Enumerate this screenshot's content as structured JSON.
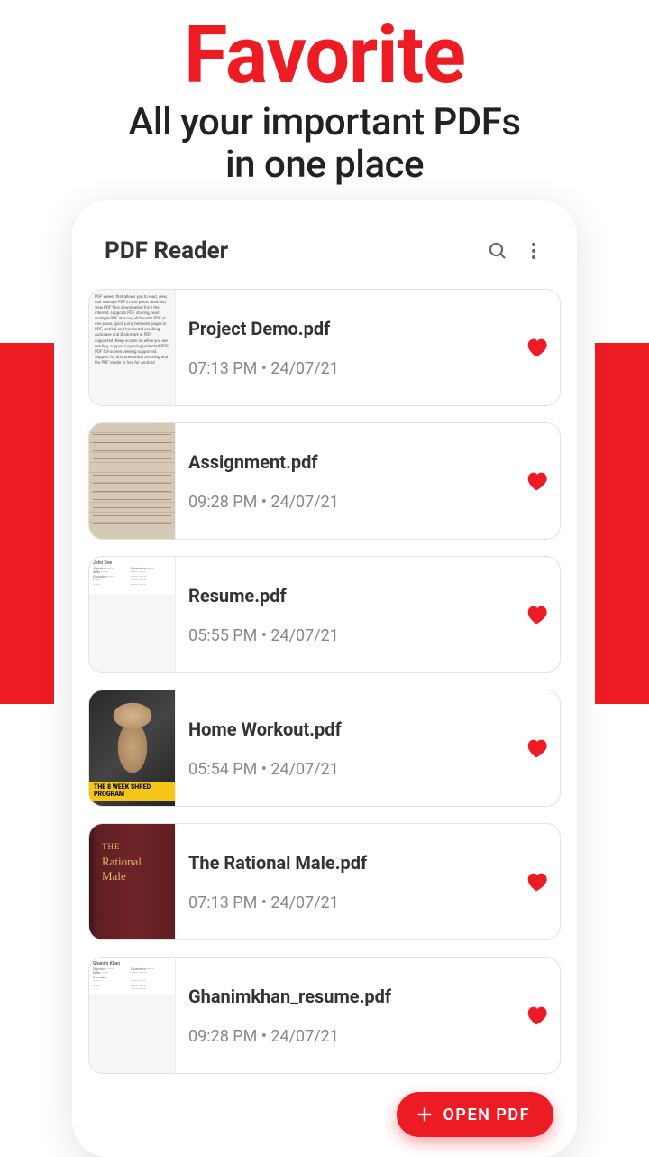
{
  "hero": {
    "title": "Favorite",
    "subtitle_line1": "All your important PDFs",
    "subtitle_line2": "in one place"
  },
  "app": {
    "title": "PDF Reader",
    "fab_label": "OPEN PDF"
  },
  "files": [
    {
      "name": "Project Demo.pdf",
      "meta": "07:13 PM • 24/07/21"
    },
    {
      "name": "Assignment.pdf",
      "meta": "09:28 PM • 24/07/21"
    },
    {
      "name": "Resume.pdf",
      "meta": "05:55 PM • 24/07/21"
    },
    {
      "name": "Home Workout.pdf",
      "meta": "05:54 PM • 24/07/21"
    },
    {
      "name": "The Rational Male.pdf",
      "meta": "07:13 PM • 24/07/21"
    },
    {
      "name": "Ghanimkhan_resume.pdf",
      "meta": "09:28 PM • 24/07/21"
    }
  ],
  "workout_thumb_label": "THE 8 WEEK SHRED PROGRAM",
  "book_thumb": {
    "l1": "THE",
    "l2": "Rational",
    "l3": "Male"
  }
}
